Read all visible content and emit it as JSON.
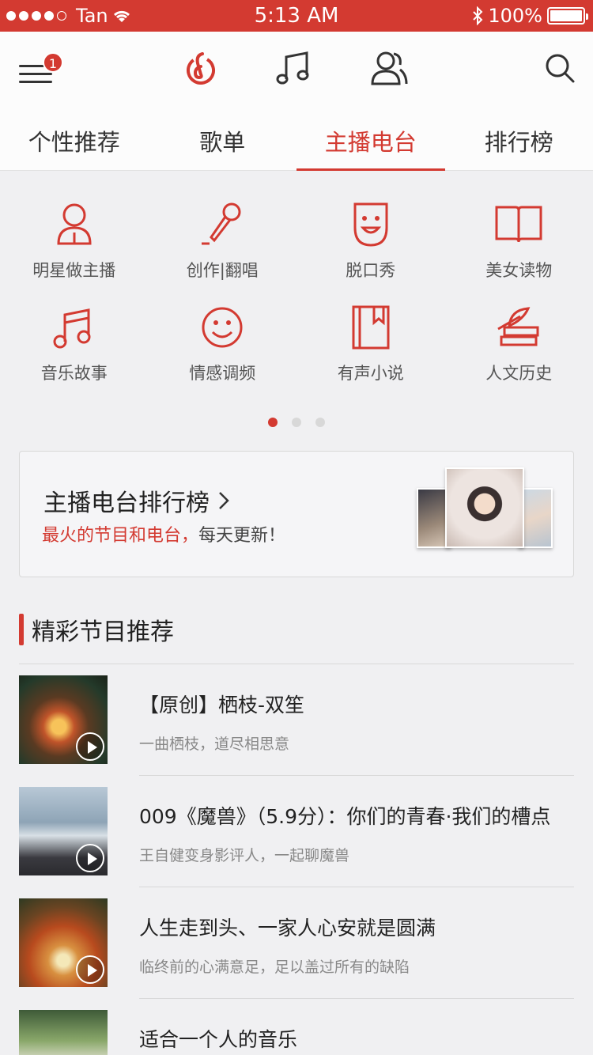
{
  "status_bar": {
    "carrier": "Tan",
    "time": "5:13 AM",
    "battery": "100%"
  },
  "top_nav": {
    "menu_badge": "1"
  },
  "tabs": [
    {
      "label": "个性推荐",
      "active": false
    },
    {
      "label": "歌单",
      "active": false
    },
    {
      "label": "主播电台",
      "active": true
    },
    {
      "label": "排行榜",
      "active": false
    }
  ],
  "categories": [
    {
      "label": "明星做主播",
      "icon": "star-host-icon"
    },
    {
      "label": "创作|翻唱",
      "icon": "microphone-icon"
    },
    {
      "label": "脱口秀",
      "icon": "mask-icon"
    },
    {
      "label": "美女读物",
      "icon": "open-book-icon"
    },
    {
      "label": "音乐故事",
      "icon": "music-note-icon"
    },
    {
      "label": "情感调频",
      "icon": "smiley-icon"
    },
    {
      "label": "有声小说",
      "icon": "bookmark-book-icon"
    },
    {
      "label": "人文历史",
      "icon": "books-stack-icon"
    }
  ],
  "pager": {
    "pages": 3,
    "current": 0
  },
  "ranking_banner": {
    "title": "主播电台排行榜",
    "subtitle_highlight": "最火的节目和电台，",
    "subtitle_rest": "每天更新！"
  },
  "section": {
    "title": "精彩节目推荐"
  },
  "programs": [
    {
      "title": "【原创】栖枝-双笙",
      "desc": "一曲栖枝，道尽相思意"
    },
    {
      "title": "009《魔兽》（5.9分）：你们的青春·我们的槽点",
      "desc": "王自健变身影评人，一起聊魔兽"
    },
    {
      "title": "人生走到头、一家人心安就是圆满",
      "desc": "临终前的心满意足，足以盖过所有的缺陷"
    },
    {
      "title": "适合一个人的音乐",
      "desc": ""
    }
  ],
  "colors": {
    "accent": "#d33a31",
    "background": "#f0f0f2"
  }
}
